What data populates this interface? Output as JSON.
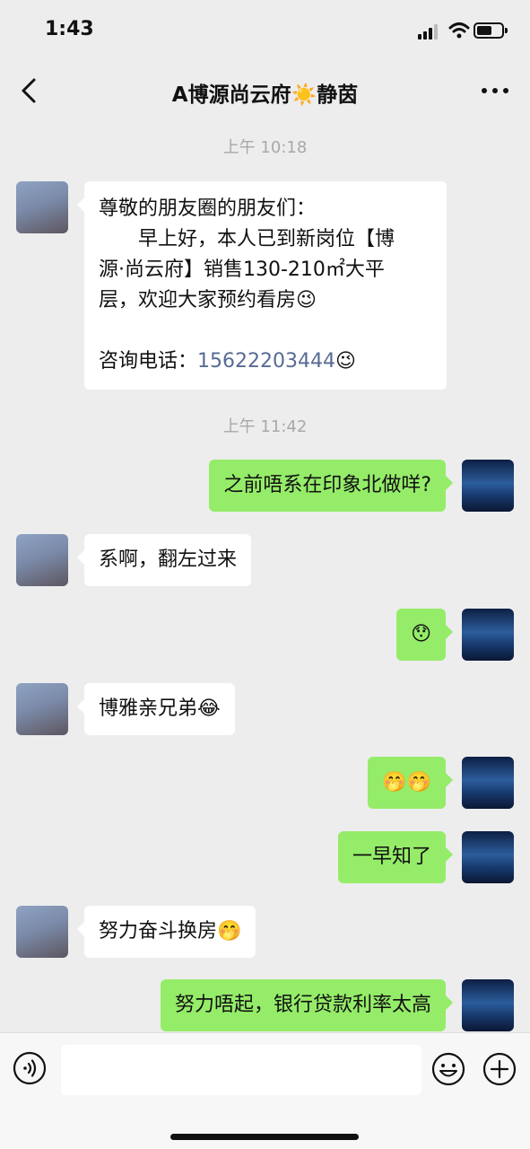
{
  "status": {
    "time": "1:43"
  },
  "nav": {
    "title": "A博源尚云府☀️静茵"
  },
  "messages": [
    {
      "type": "time",
      "text": "上午 10:18"
    },
    {
      "type": "in",
      "line1": "尊敬的朋友圈的朋友们：",
      "line2": "　　早上好，本人已到新岗位【博",
      "line3": "源·尚云府】销售130-210㎡大平",
      "line4": "层，欢迎大家预约看房😉",
      "line5_label": "咨询电话：",
      "phone": "15622203444",
      "emoji": "😉"
    },
    {
      "type": "time",
      "text": "上午 11:42"
    },
    {
      "type": "out",
      "text": "之前唔系在印象北做咩?"
    },
    {
      "type": "in",
      "text": "系啊，翻左过来"
    },
    {
      "type": "out",
      "text": "😯"
    },
    {
      "type": "in",
      "text": "博雅亲兄弟😂"
    },
    {
      "type": "out",
      "text": "🤭🤭"
    },
    {
      "type": "out",
      "text": "一早知了"
    },
    {
      "type": "in",
      "text": "努力奋斗换房🤭"
    },
    {
      "type": "out",
      "text": "努力唔起，银行贷款利率太高"
    }
  ],
  "input": {
    "placeholder": ""
  }
}
